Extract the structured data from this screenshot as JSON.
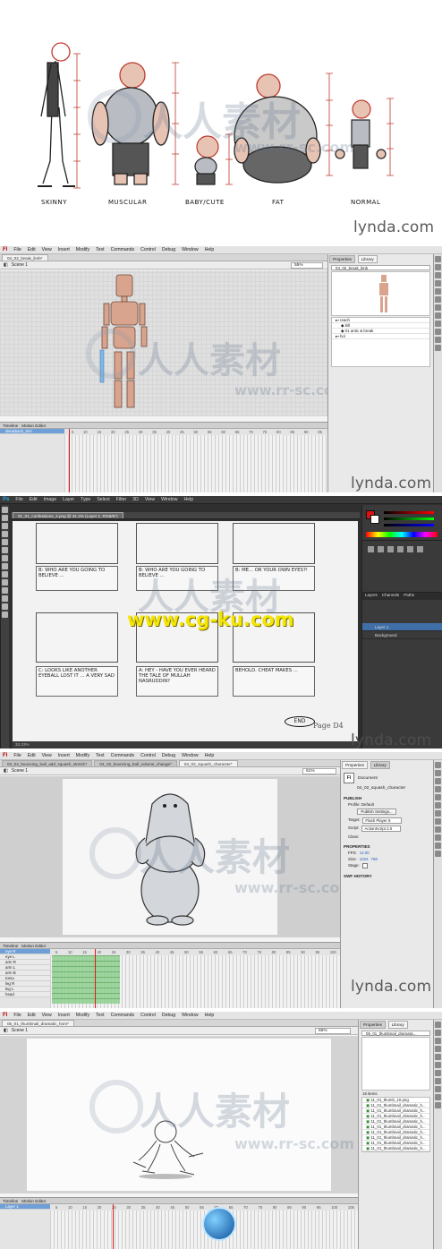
{
  "colors": {
    "menubar": "#e4e4e4",
    "ps_dark": "#3a3a3a",
    "timeline_selected": "#6f9fd8",
    "playhead": "#e0191e",
    "construction_red": "#c0392b"
  },
  "panel1": {
    "labels": [
      "SKINNY",
      "MUSCULAR",
      "BABY/CUTE",
      "FAT",
      "NORMAL"
    ],
    "logo": "lynda.com"
  },
  "panel2": {
    "app_logo": "Fl",
    "menu": [
      "File",
      "Edit",
      "View",
      "Insert",
      "Modify",
      "Text",
      "Commands",
      "Control",
      "Debug",
      "Window",
      "Help"
    ],
    "tab": "04_02_break_limb*",
    "scene": "Scene 1",
    "zoom": "55%",
    "right_tabs": [
      "Properties",
      "Library"
    ],
    "library_file": "04_02_break_limb",
    "library_items": [
      "reach",
      "bill",
      "01 antic & break",
      "hol"
    ],
    "timeline_tabs": [
      "Timeline",
      "Motion Editor"
    ],
    "layers": [
      "skin&back_trim"
    ],
    "frame_numbers": [
      "5",
      "10",
      "15",
      "20",
      "25",
      "30",
      "35",
      "40",
      "45",
      "50",
      "55",
      "60",
      "65",
      "70",
      "75",
      "80",
      "85",
      "90",
      "95"
    ],
    "logo": "lynda.com"
  },
  "panel3": {
    "app_logo": "Ps",
    "menu": [
      "File",
      "Edit",
      "Image",
      "Layer",
      "Type",
      "Select",
      "Filter",
      "3D",
      "View",
      "Window",
      "Help"
    ],
    "tab": "01_01_confessions_4.png @ 31.2% (Layer 1, RGB/8*)",
    "status": "33.33%",
    "captions": [
      "B: WHO ARE YOU GOING TO BELIEVE ...",
      "B: WHO ARE YOU GOING TO BELIEVE ...",
      "B: ME... OR YOUR OWN EYES?!",
      "C: LOOKS LIKE ANOTHER EYEBALL LOST IT ... A VERY SAD",
      "A: HEY - HAVE YOU EVER HEARD THE TALE OF MULLAH NASRUDDIN?",
      "BEHOLD. CHEAT MAKES ..."
    ],
    "end_label": "END",
    "page_label": "Page D4",
    "layers_tabs": [
      "Layers",
      "Channels",
      "Paths"
    ],
    "layers": [
      "Layer 1",
      "Background"
    ],
    "watermark_url": "www.cg-ku.com",
    "logo": "lynda.com"
  },
  "panel4": {
    "app_logo": "Fl",
    "menu": [
      "File",
      "Edit",
      "View",
      "Insert",
      "Modify",
      "Text",
      "Commands",
      "Control",
      "Debug",
      "Window",
      "Help"
    ],
    "tabs": [
      "03_04_bouncing_ball_add_squash_stretch*",
      "04_02_bouncing_ball_volume_change*",
      "04_02_squash_character*"
    ],
    "scene": "Scene 1",
    "zoom": "61%",
    "right_tabs": [
      "Properties",
      "Library"
    ],
    "doc_label": "Document",
    "doc_name": "04_02_squash_character",
    "sections": [
      "PUBLISH",
      "PROPERTIES",
      "SWF HISTORY"
    ],
    "profile": "Profile: Default",
    "publish_button": "Publish Settings...",
    "target_label": "Target:",
    "target_value": "Flash Player 8",
    "script_label": "Script:",
    "script_value": "ActionScript 2.0",
    "class_label": "Class:",
    "fps_label": "FPS:",
    "fps_value": "12.00",
    "size_label": "Size:",
    "size_w": "1024",
    "size_h": "768",
    "stage_label": "Stage:",
    "timeline_tabs": [
      "Timeline",
      "Motion Editor"
    ],
    "layers": [
      "eye R",
      "eye L",
      "arm R",
      "arm L",
      "arm B",
      "torso",
      "leg R",
      "leg L",
      "head"
    ],
    "frame_numbers": [
      "5",
      "10",
      "15",
      "20",
      "25",
      "30",
      "35",
      "40",
      "45",
      "50",
      "55",
      "60",
      "65",
      "70",
      "75",
      "80",
      "85",
      "90",
      "95",
      "100"
    ],
    "logo": "lynda.com"
  },
  "panel5": {
    "app_logo": "Fl",
    "menu": [
      "File",
      "Edit",
      "View",
      "Insert",
      "Modify",
      "Text",
      "Commands",
      "Control",
      "Debug",
      "Window",
      "Help"
    ],
    "tab": "05_01_thumbnail_dramatic_horn*",
    "scene": "Scene 1",
    "zoom": "66%",
    "right_tabs": [
      "Properties",
      "Library"
    ],
    "library_file": "05_01_thumbnail_dramatic...",
    "library_count": "16 items",
    "library_items": [
      "11_01_thumb_10.png",
      "11_01_thumbnail_dramatic_h...",
      "11_01_thumbnail_dramatic_h...",
      "11_01_thumbnail_dramatic_h...",
      "11_01_thumbnail_dramatic_h...",
      "11_01_thumbnail_dramatic_h...",
      "11_01_thumbnail_dramatic_h...",
      "11_01_thumbnail_dramatic_h...",
      "11_01_thumbnail_dramatic_h...",
      "11_01_thumbnail_dramatic_h..."
    ],
    "timeline_tabs": [
      "Timeline",
      "Motion Editor"
    ],
    "layers": [
      "Layer 1"
    ],
    "frame_numbers": [
      "5",
      "10",
      "15",
      "20",
      "25",
      "30",
      "35",
      "40",
      "45",
      "50",
      "55",
      "60",
      "65",
      "70",
      "75",
      "80",
      "85",
      "90",
      "95",
      "100",
      "105"
    ]
  },
  "watermark": {
    "text": "人人素材",
    "url": "www.rr-sc.com"
  }
}
